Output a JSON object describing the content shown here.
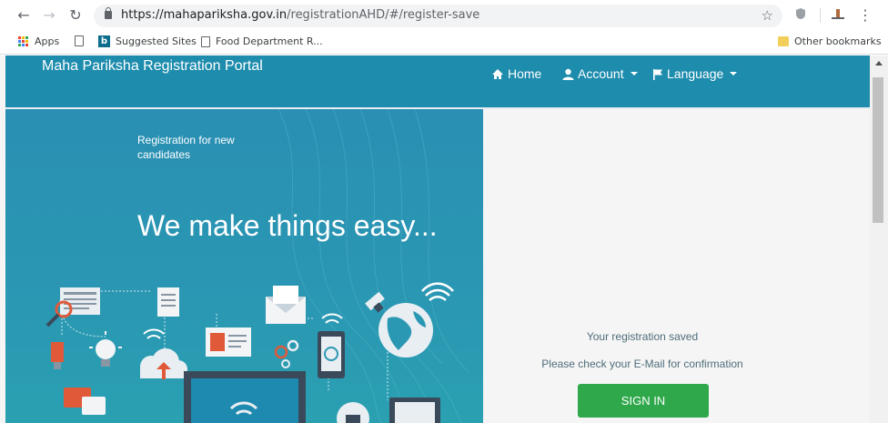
{
  "browser": {
    "url_host": "https://mahapariksha.gov.in",
    "url_path": "/registrationAHD/#/register-save",
    "bookmarks": [
      {
        "label": "Apps"
      },
      {
        "label": "Suggested Sites"
      },
      {
        "label": "Food Department R..."
      }
    ],
    "other_bookmarks": "Other bookmarks"
  },
  "header": {
    "brand": "Maha Pariksha Registration Portal",
    "nav": {
      "home": "Home",
      "account": "Account",
      "language": "Language"
    }
  },
  "hero": {
    "subtitle": "Registration for new candidates",
    "title": "We make things easy..."
  },
  "panel": {
    "message": "Your registration saved",
    "instruction": "Please check your E-Mail for confirmation",
    "signin_label": "SIGN IN"
  },
  "colors": {
    "header_bg": "#1e8cad",
    "hero_bg": "#2a97b3",
    "signin_bg": "#2ea84a"
  }
}
